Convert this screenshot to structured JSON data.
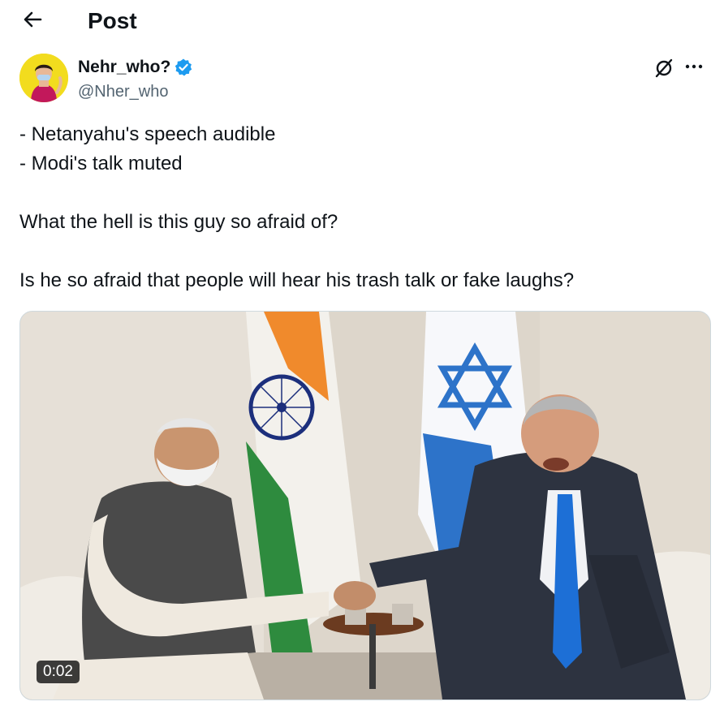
{
  "header": {
    "title": "Post",
    "back_icon": "arrow-left-icon"
  },
  "author": {
    "display_name": "Nehr_who?",
    "handle": "@Nher_who",
    "verified": true,
    "verified_color": "#1d9bf0"
  },
  "tweet": {
    "lines": [
      "- Netanyahu's speech audible",
      "- Modi's talk muted",
      "What the hell is this guy so afraid of?",
      "Is he so afraid that people will hear his trash talk or fake laughs?"
    ]
  },
  "media": {
    "type": "video",
    "duration": "0:02"
  },
  "colors": {
    "text_primary": "#0f1419",
    "text_secondary": "#536471",
    "border": "#cfd9de"
  }
}
